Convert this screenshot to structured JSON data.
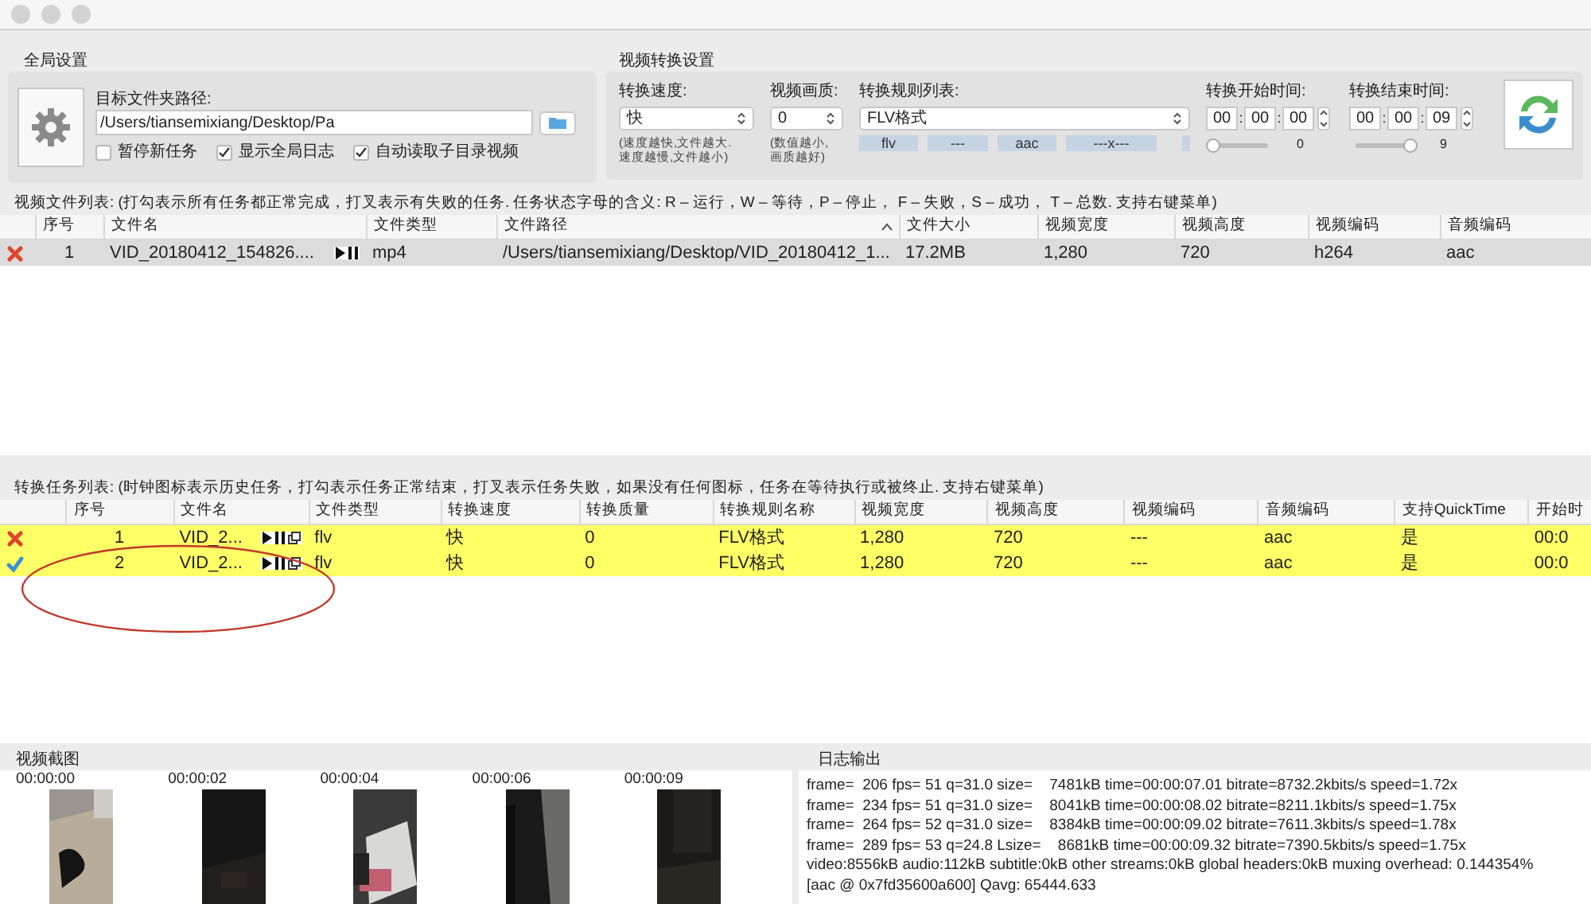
{
  "global_settings": {
    "title": "全局设置",
    "target_label": "目标文件夹路径:",
    "path_value": "/Users/tiansemixiang/Desktop/Pa",
    "checkboxes": [
      {
        "label": "暂停新任务",
        "checked": false
      },
      {
        "label": "显示全局日志",
        "checked": true
      },
      {
        "label": "自动读取子目录视频",
        "checked": true
      }
    ]
  },
  "video_settings": {
    "title": "视频转换设置",
    "speed": {
      "label": "转换速度:",
      "value": "快",
      "hint": "(速度越快,文件越大.\n速度越慢,文件越小)"
    },
    "quality": {
      "label": "视频画质:",
      "value": "0",
      "hint": "(数值越小,\n画质越好)"
    },
    "rules": {
      "label": "转换规则列表:",
      "value": "FLV格式",
      "tags": [
        "flv",
        "---",
        "aac",
        "---x---"
      ]
    },
    "start": {
      "label": "转换开始时间:",
      "fields": [
        "00",
        "00",
        "00"
      ],
      "separators": [
        ":",
        ":"
      ],
      "level": 0,
      "reading": "0"
    },
    "end": {
      "label": "转换结束时间:",
      "fields": [
        "00",
        "00",
        "09"
      ],
      "separators": [
        ":",
        ":"
      ],
      "level": 1,
      "reading": "9"
    }
  },
  "file_list": {
    "caption": "视频文件列表: (打勾表示所有任务都正常完成，打叉表示有失败的任务.  任务状态字母的含义: R – 运行，W – 等待，P – 停止，  F – 失败，S – 成功，  T – 总数. 支持右键菜单)",
    "columns": [
      "序号",
      "文件名",
      "文件类型",
      "文件路径",
      "文件大小",
      "视频宽度",
      "视频高度",
      "视频编码",
      "音频编码"
    ],
    "rows": [
      {
        "failed": true,
        "selected": true,
        "cells": [
          "1",
          "VID_20180412_154826....",
          "mp4",
          "/Users/tiansemixiang/Desktop/VID_20180412_1...",
          "17.2MB",
          "1,280",
          "720",
          "h264",
          "aac"
        ]
      }
    ]
  },
  "task_list": {
    "caption": "转换任务列表: (时钟图标表示历史任务，打勾表示任务正常结束，打叉表示任务失败，如果没有任何图标，任务在等待执行或被终止. 支持右键菜单)",
    "columns": [
      "序号",
      "文件名",
      "文件类型",
      "转换速度",
      "转换质量",
      "转换规则名称",
      "视频宽度",
      "视频高度",
      "视频编码",
      "音频编码",
      "支持QuickTime",
      "开始时"
    ],
    "rows": [
      {
        "failed": true,
        "highlighted": true,
        "cells": [
          "1",
          "VID_2...",
          "flv",
          "快",
          "0",
          "FLV格式",
          "1,280",
          "720",
          "---",
          "aac",
          "是",
          "00:0"
        ]
      },
      {
        "failed": false,
        "highlighted": true,
        "cells": [
          "2",
          "VID_2...",
          "flv",
          "快",
          "0",
          "FLV格式",
          "1,280",
          "720",
          "---",
          "aac",
          "是",
          "00:0"
        ]
      }
    ]
  },
  "screenshots": {
    "title": "视频截图",
    "frames": [
      {
        "time": "00:00:00",
        "kind": "picture"
      },
      {
        "time": "00:00:02",
        "kind": "picture"
      },
      {
        "time": "00:00:04",
        "kind": "picture"
      },
      {
        "time": "00:00:06",
        "kind": "picture"
      },
      {
        "time": "00:00:09",
        "kind": "picture"
      }
    ]
  },
  "log": {
    "title": "日志输出",
    "lines": [
      "frame=  206 fps= 51 q=31.0 size=    7481kB time=00:00:07.01 bitrate=8732.2kbits/s speed=1.72x",
      "frame=  234 fps= 51 q=31.0 size=    8041kB time=00:00:08.02 bitrate=8211.1kbits/s speed=1.75x",
      "frame=  264 fps= 52 q=31.0 size=    8384kB time=00:00:09.02 bitrate=7611.3kbits/s speed=1.78x",
      "frame=  289 fps= 53 q=24.8 Lsize=    8681kB time=00:00:09.32 bitrate=7390.5kbits/s speed=1.75x",
      "video:8556kB audio:112kB subtitle:0kB other streams:0kB global headers:0kB muxing overhead: 0.144354%",
      "[aac @ 0x7fd35600a600] Qavg: 65444.633"
    ]
  }
}
